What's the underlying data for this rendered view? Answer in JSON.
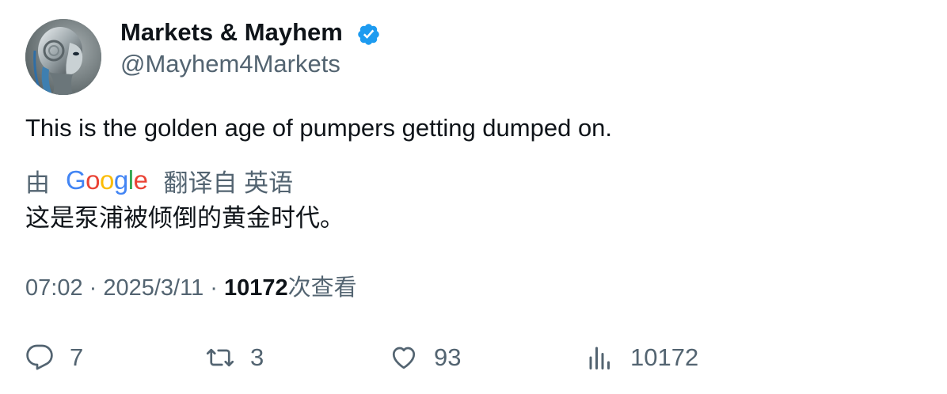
{
  "author": {
    "display_name": "Markets & Mayhem",
    "handle": "@Mayhem4Markets",
    "verified_icon": "verified-badge-icon",
    "verified_color": "#1d9bf0"
  },
  "tweet": {
    "text": "This is the golden age of pumpers getting dumped on."
  },
  "translation": {
    "prefix": "由",
    "provider_logo": "Google",
    "suffix": "翻译自 英语",
    "text": "这是泵浦被倾倒的黄金时代。"
  },
  "meta": {
    "time": "07:02",
    "separator": "·",
    "date": "2025/3/11",
    "views_count": "10172",
    "views_label": "次查看"
  },
  "actions": {
    "reply": {
      "icon": "reply-icon",
      "count": "7"
    },
    "retweet": {
      "icon": "retweet-icon",
      "count": "3"
    },
    "like": {
      "icon": "heart-icon",
      "count": "93"
    },
    "views": {
      "icon": "analytics-icon",
      "count": "10172"
    }
  },
  "colors": {
    "text_primary": "#0f1419",
    "text_secondary": "#536471",
    "google_blue": "#4285f4",
    "google_red": "#ea4335",
    "google_yellow": "#fbbc05",
    "google_green": "#34a853"
  }
}
